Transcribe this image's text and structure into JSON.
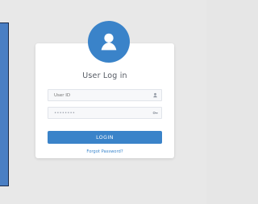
{
  "login": {
    "title": "User Log in",
    "userid_placeholder": "User ID",
    "password_value": "••••••••",
    "button_label": "LOGIN",
    "forgot_label": "Forgot Password?",
    "accent_color": "#3a83c9"
  },
  "icons": {
    "avatar": "user-avatar-icon",
    "user": "user-icon",
    "key": "key-icon"
  }
}
